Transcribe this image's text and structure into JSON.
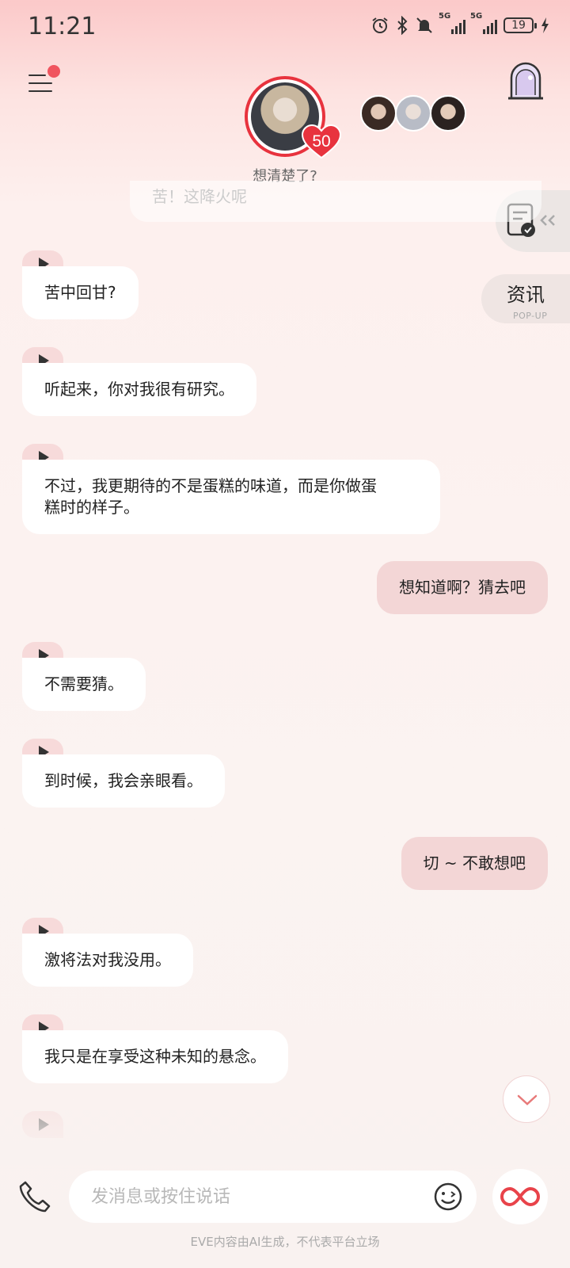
{
  "status_bar": {
    "time": "11:21",
    "net1": "5G",
    "net2": "5G",
    "battery": "19"
  },
  "header": {
    "affection_level": "50",
    "subtitle": "想清楚了?"
  },
  "side": {
    "news_label": "资讯",
    "news_sub": "POP-UP"
  },
  "chat": {
    "faded_previous": "苦！这降火呢",
    "messages": [
      {
        "from": "char",
        "text": "苦中回甘?"
      },
      {
        "from": "char",
        "text": "听起来，你对我很有研究。"
      },
      {
        "from": "char",
        "text": "不过，我更期待的不是蛋糕的味道，而是你做蛋\n糕时的样子。"
      },
      {
        "from": "user",
        "text": "想知道啊？猜去吧"
      },
      {
        "from": "char",
        "text": "不需要猜。"
      },
      {
        "from": "char",
        "text": "到时候，我会亲眼看。"
      },
      {
        "from": "user",
        "text": "切 ~ 不敢想吧"
      },
      {
        "from": "char",
        "text": "激将法对我没用。"
      },
      {
        "from": "char",
        "text": "我只是在享受这种未知的悬念。"
      }
    ]
  },
  "input": {
    "placeholder": "发消息或按住说话"
  },
  "footer": {
    "disclaimer": "EVE内容由AI生成，不代表平台立场"
  },
  "colors": {
    "accent": "#e8333e",
    "user_bubble": "#f3d6d6",
    "voice_tab": "#f7dada"
  },
  "icons": [
    "alarm-icon",
    "bluetooth-icon",
    "mute-icon",
    "signal-icon",
    "battery-icon",
    "charging-icon",
    "menu-icon",
    "window-icon",
    "task-icon",
    "play-icon",
    "phone-icon",
    "emoji-icon",
    "infinity-icon",
    "chevron-down-icon"
  ]
}
